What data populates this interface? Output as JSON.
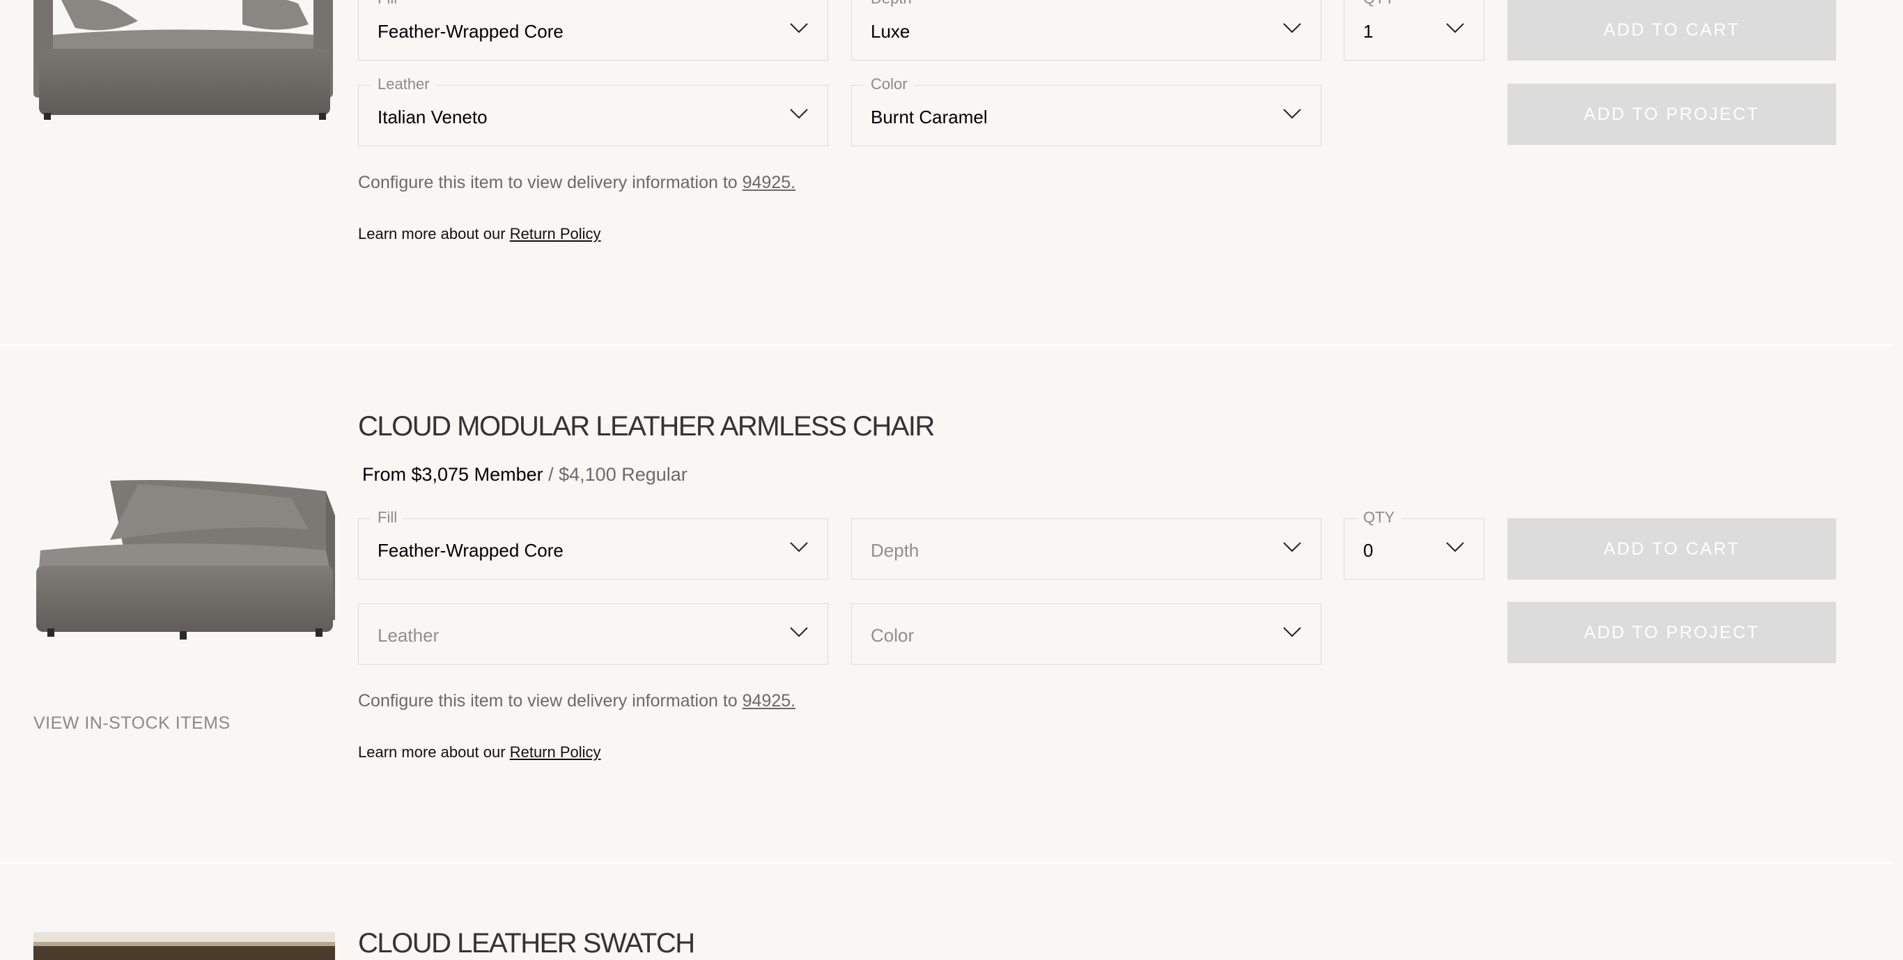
{
  "item1": {
    "fields": {
      "fill": {
        "label": "Fill",
        "value": "Feather-Wrapped Core"
      },
      "depth": {
        "label": "Depth",
        "value": "Luxe"
      },
      "qty": {
        "label": "QTY",
        "value": "1"
      },
      "leather": {
        "label": "Leather",
        "value": "Italian Veneto"
      },
      "color": {
        "label": "Color",
        "value": "Burnt Caramel"
      }
    },
    "add_to_cart": "ADD TO CART",
    "add_to_project": "ADD TO PROJECT",
    "delivery_text": "Configure this item to view delivery information to ",
    "zip": "94925.",
    "policy_text": "Learn more about our ",
    "policy_link": "Return Policy"
  },
  "item2": {
    "title": "CLOUD MODULAR LEATHER ARMLESS CHAIR",
    "price_member": "From $3,075 Member",
    "price_separator": " / ",
    "price_regular": "$4,100 Regular",
    "fields": {
      "fill": {
        "label": "Fill",
        "value": "Feather-Wrapped Core"
      },
      "depth": {
        "placeholder": "Depth"
      },
      "qty": {
        "label": "QTY",
        "value": "0"
      },
      "leather": {
        "placeholder": "Leather"
      },
      "color": {
        "placeholder": "Color"
      }
    },
    "add_to_cart": "ADD TO CART",
    "add_to_project": "ADD TO PROJECT",
    "view_in_stock": "VIEW IN-STOCK ITEMS",
    "delivery_text": "Configure this item to view delivery information to ",
    "zip": "94925.",
    "policy_text": "Learn more about our ",
    "policy_link": "Return Policy"
  },
  "item3": {
    "title": "CLOUD LEATHER SWATCH"
  },
  "colors": {
    "page_background": "#f8f7f4",
    "field_border": "#dedcd8",
    "disabled_button": "#dcdcdc",
    "muted_text": "#6a6a6a"
  }
}
